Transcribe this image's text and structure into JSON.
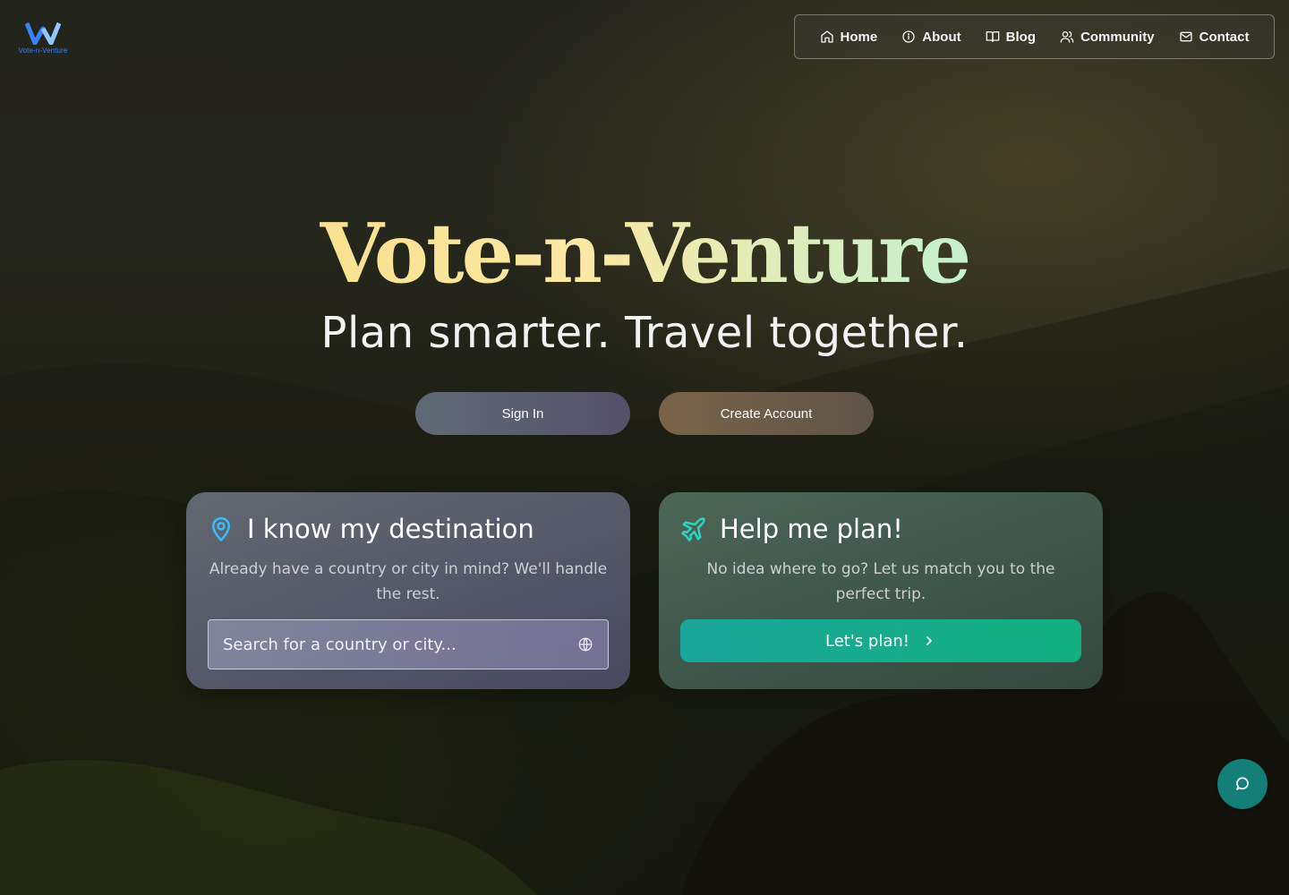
{
  "brand": {
    "logo_text": "Vote-n-Venture",
    "logo_color": "#3b82f6"
  },
  "nav": {
    "items": [
      {
        "label": "Home",
        "icon": "home-icon"
      },
      {
        "label": "About",
        "icon": "info-icon"
      },
      {
        "label": "Blog",
        "icon": "book-icon"
      },
      {
        "label": "Community",
        "icon": "users-icon"
      },
      {
        "label": "Contact",
        "icon": "mail-icon"
      }
    ]
  },
  "hero": {
    "title": "Vote-n-Venture",
    "subtitle": "Plan smarter. Travel together.",
    "sign_in_label": "Sign In",
    "create_account_label": "Create Account"
  },
  "cards": {
    "destination": {
      "title": "I know my destination",
      "description": "Already have a country or city in mind? We'll handle the rest.",
      "search_placeholder": "Search for a country or city...",
      "icon": "map-pin-icon",
      "accent": "#38bdf8"
    },
    "plan": {
      "title": "Help me plan!",
      "description": "No idea where to go? Let us match you to the perfect trip.",
      "button_label": "Let's plan!",
      "icon": "plane-icon",
      "accent": "#2dd4bf"
    }
  },
  "chat": {
    "icon": "chat-bubble-icon",
    "color": "#137f78"
  }
}
